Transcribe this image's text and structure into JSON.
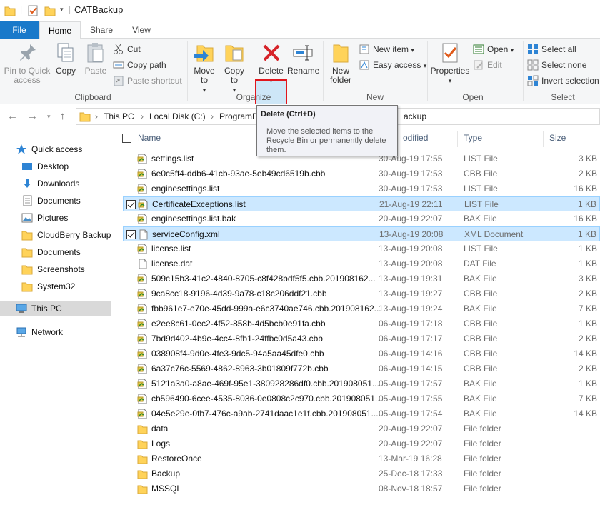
{
  "window": {
    "title": "CATBackup"
  },
  "tabs": [
    {
      "label": "File"
    },
    {
      "label": "Home"
    },
    {
      "label": "Share"
    },
    {
      "label": "View"
    }
  ],
  "ribbon": {
    "clipboard": {
      "pin": "Pin to Quick access",
      "copy": "Copy",
      "paste": "Paste",
      "cut": "Cut",
      "copy_path": "Copy path",
      "paste_shortcut": "Paste shortcut",
      "label": "Clipboard"
    },
    "organize": {
      "move_to": "Move to",
      "copy_to": "Copy to",
      "delete": "Delete",
      "rename": "Rename",
      "label": "Organize"
    },
    "new": {
      "new_folder": "New folder",
      "new_item": "New item",
      "easy_access": "Easy access",
      "label": "New"
    },
    "open": {
      "properties": "Properties",
      "open": "Open",
      "edit": "Edit",
      "label": "Open"
    },
    "select": {
      "select_all": "Select all",
      "select_none": "Select none",
      "invert": "Invert selection",
      "label": "Select"
    }
  },
  "address": {
    "crumbs": [
      "This PC",
      "Local Disk (C:)",
      "ProgramD"
    ],
    "tail": "ackup"
  },
  "tooltip": {
    "title": "Delete (Ctrl+D)",
    "body": "Move the selected items to the Recycle Bin or permanently delete them."
  },
  "sidebar": {
    "quick_access": "Quick access",
    "items": [
      "Desktop",
      "Downloads",
      "Documents",
      "Pictures",
      "CloudBerry Backup",
      "Documents",
      "Screenshots",
      "System32"
    ],
    "this_pc": "This PC",
    "network": "Network"
  },
  "columns": {
    "name": "Name",
    "modified": "odified",
    "type": "Type",
    "size": "Size"
  },
  "files": [
    {
      "name": "settings.list",
      "date": "30-Aug-19 17:55",
      "type": "LIST File",
      "size": "3 KB",
      "icon": "file-green",
      "selected": false
    },
    {
      "name": "6e0c5ff4-ddb6-41cb-93ae-5eb49cd6519b.cbb",
      "date": "30-Aug-19 17:53",
      "type": "CBB File",
      "size": "2 KB",
      "icon": "file-green",
      "selected": false
    },
    {
      "name": "enginesettings.list",
      "date": "30-Aug-19 17:53",
      "type": "LIST File",
      "size": "16 KB",
      "icon": "file-green",
      "selected": false
    },
    {
      "name": "CertificateExceptions.list",
      "date": "21-Aug-19 22:11",
      "type": "LIST File",
      "size": "1 KB",
      "icon": "file-green",
      "selected": true
    },
    {
      "name": "enginesettings.list.bak",
      "date": "20-Aug-19 22:07",
      "type": "BAK File",
      "size": "16 KB",
      "icon": "file-green",
      "selected": false
    },
    {
      "name": "serviceConfig.xml",
      "date": "13-Aug-19 20:08",
      "type": "XML Document",
      "size": "1 KB",
      "icon": "file-blank",
      "selected": true
    },
    {
      "name": "license.list",
      "date": "13-Aug-19 20:08",
      "type": "LIST File",
      "size": "1 KB",
      "icon": "file-green",
      "selected": false
    },
    {
      "name": "license.dat",
      "date": "13-Aug-19 20:08",
      "type": "DAT File",
      "size": "1 KB",
      "icon": "file-blank",
      "selected": false
    },
    {
      "name": "509c15b3-41c2-4840-8705-c8f428bdf5f5.cbb.201908162...",
      "date": "13-Aug-19 19:31",
      "type": "BAK File",
      "size": "3 KB",
      "icon": "file-green",
      "selected": false
    },
    {
      "name": "9ca8cc18-9196-4d39-9a78-c18c206ddf21.cbb",
      "date": "13-Aug-19 19:27",
      "type": "CBB File",
      "size": "2 KB",
      "icon": "file-green",
      "selected": false
    },
    {
      "name": "fbb961e7-e70e-45dd-999a-e6c3740ae746.cbb.201908162...",
      "date": "13-Aug-19 19:24",
      "type": "BAK File",
      "size": "7 KB",
      "icon": "file-green",
      "selected": false
    },
    {
      "name": "e2ee8c61-0ec2-4f52-858b-4d5bcb0e91fa.cbb",
      "date": "06-Aug-19 17:18",
      "type": "CBB File",
      "size": "1 KB",
      "icon": "file-green",
      "selected": false
    },
    {
      "name": "7bd9d402-4b9e-4cc4-8fb1-24ffbc0d5a43.cbb",
      "date": "06-Aug-19 17:17",
      "type": "CBB File",
      "size": "2 KB",
      "icon": "file-green",
      "selected": false
    },
    {
      "name": "038908f4-9d0e-4fe3-9dc5-94a5aa45dfe0.cbb",
      "date": "06-Aug-19 14:16",
      "type": "CBB File",
      "size": "14 KB",
      "icon": "file-green",
      "selected": false
    },
    {
      "name": "6a37c76c-5569-4862-8963-3b01809f772b.cbb",
      "date": "06-Aug-19 14:15",
      "type": "CBB File",
      "size": "2 KB",
      "icon": "file-green",
      "selected": false
    },
    {
      "name": "5121a3a0-a8ae-469f-95e1-380928286df0.cbb.201908051...",
      "date": "05-Aug-19 17:57",
      "type": "BAK File",
      "size": "1 KB",
      "icon": "file-green",
      "selected": false
    },
    {
      "name": "cb596490-6cee-4535-8036-0e0808c2c970.cbb.201908051...",
      "date": "05-Aug-19 17:55",
      "type": "BAK File",
      "size": "7 KB",
      "icon": "file-green",
      "selected": false
    },
    {
      "name": "04e5e29e-0fb7-476c-a9ab-2741daac1e1f.cbb.201908051...",
      "date": "05-Aug-19 17:54",
      "type": "BAK File",
      "size": "14 KB",
      "icon": "file-green",
      "selected": false
    },
    {
      "name": "data",
      "date": "20-Aug-19 22:07",
      "type": "File folder",
      "size": "",
      "icon": "folder",
      "selected": false
    },
    {
      "name": "Logs",
      "date": "20-Aug-19 22:07",
      "type": "File folder",
      "size": "",
      "icon": "folder",
      "selected": false
    },
    {
      "name": "RestoreOnce",
      "date": "13-Mar-19 16:28",
      "type": "File folder",
      "size": "",
      "icon": "folder",
      "selected": false
    },
    {
      "name": "Backup",
      "date": "25-Dec-18 17:33",
      "type": "File folder",
      "size": "",
      "icon": "folder",
      "selected": false
    },
    {
      "name": "MSSQL",
      "date": "08-Nov-18 18:57",
      "type": "File folder",
      "size": "",
      "icon": "folder",
      "selected": false
    }
  ]
}
